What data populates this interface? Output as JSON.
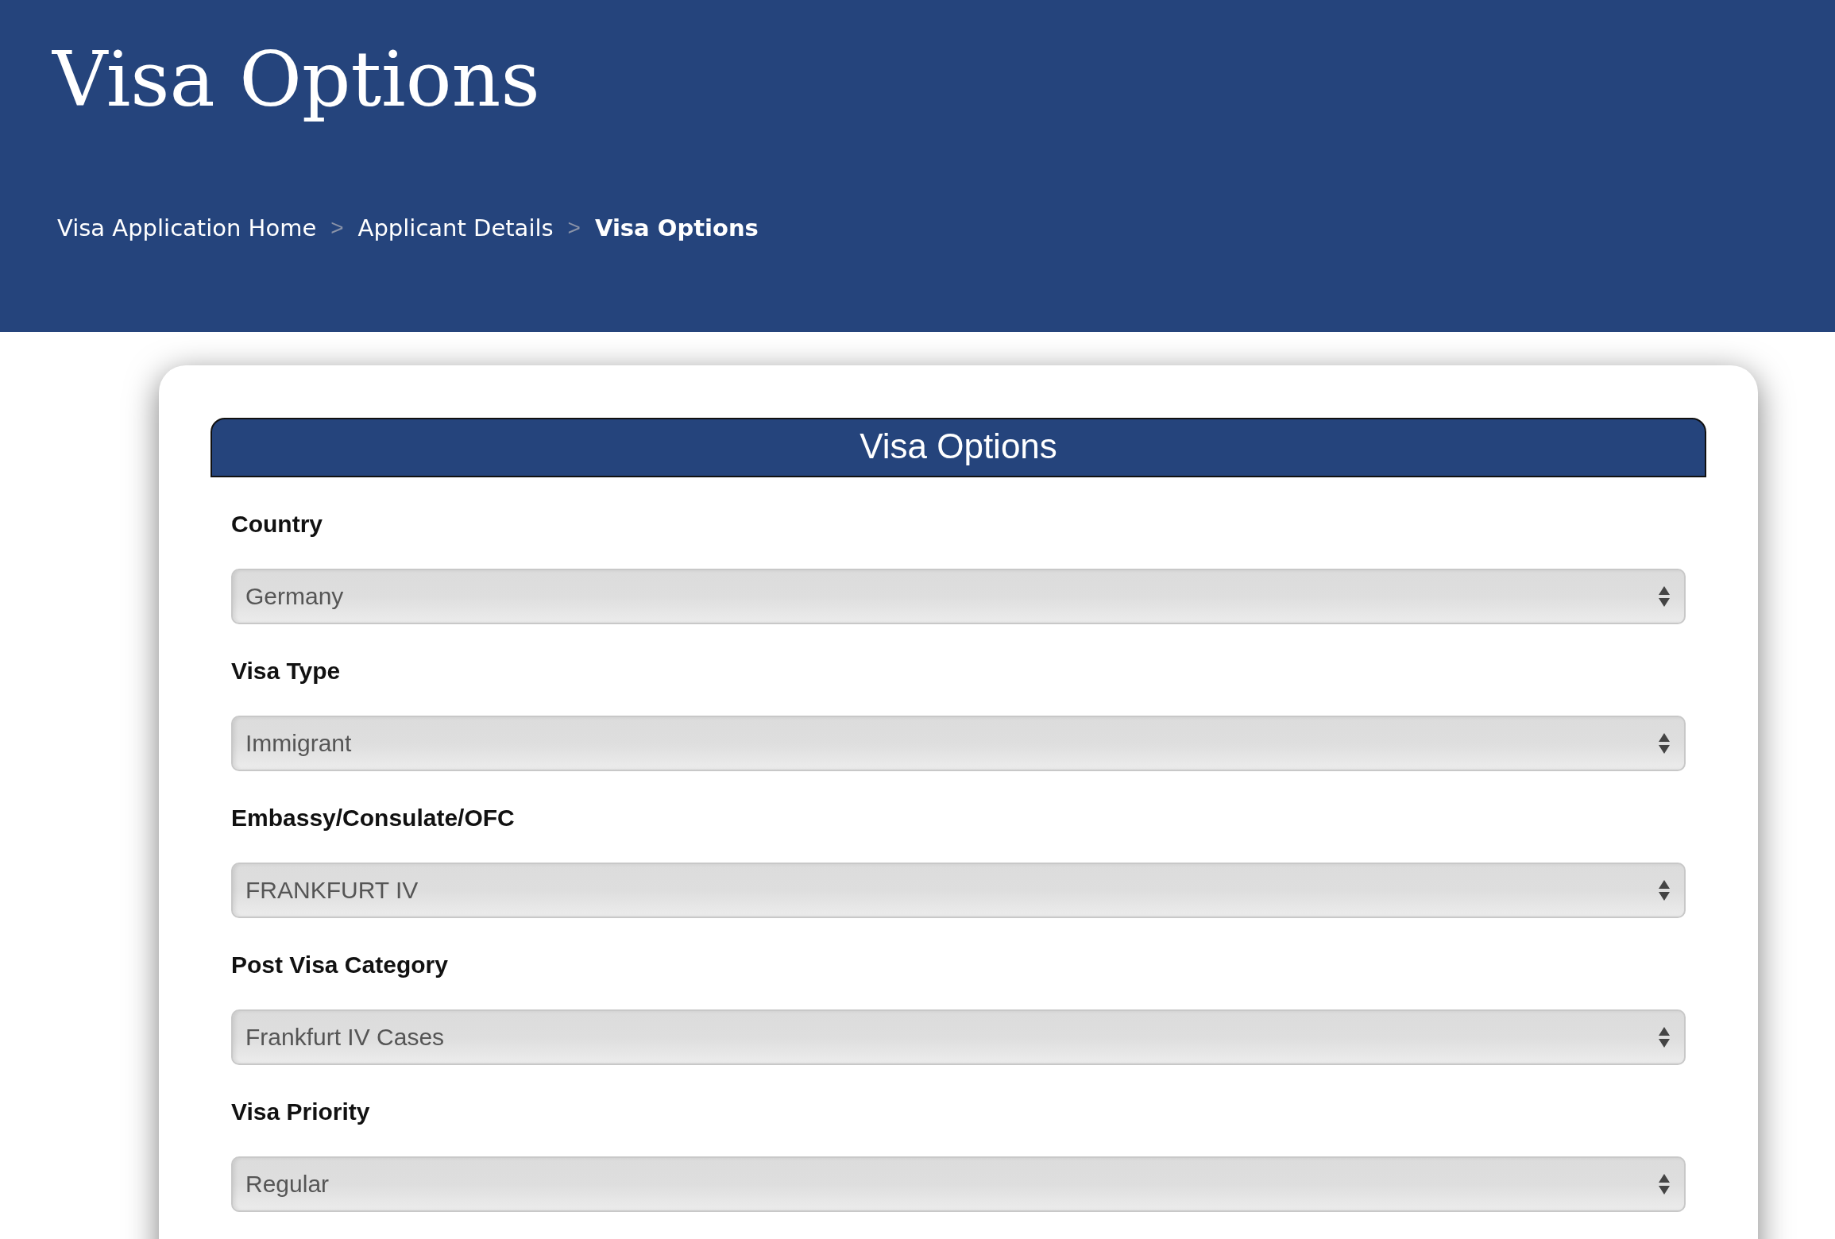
{
  "header": {
    "title": "Visa Options"
  },
  "breadcrumb": [
    {
      "label": "Visa Application Home",
      "separator": ">",
      "current": false
    },
    {
      "label": "Applicant Details",
      "separator": ">",
      "current": false
    },
    {
      "label": "Visa Options",
      "current": true
    }
  ],
  "panel": {
    "title": "Visa Options"
  },
  "fields": [
    {
      "label": "Country",
      "value": "Germany"
    },
    {
      "label": "Visa Type",
      "value": "Immigrant"
    },
    {
      "label": "Embassy/Consulate/OFC",
      "value": "FRANKFURT IV"
    },
    {
      "label": "Post Visa Category",
      "value": "Frankfurt IV Cases"
    },
    {
      "label": "Visa Priority",
      "value": "Regular"
    }
  ]
}
